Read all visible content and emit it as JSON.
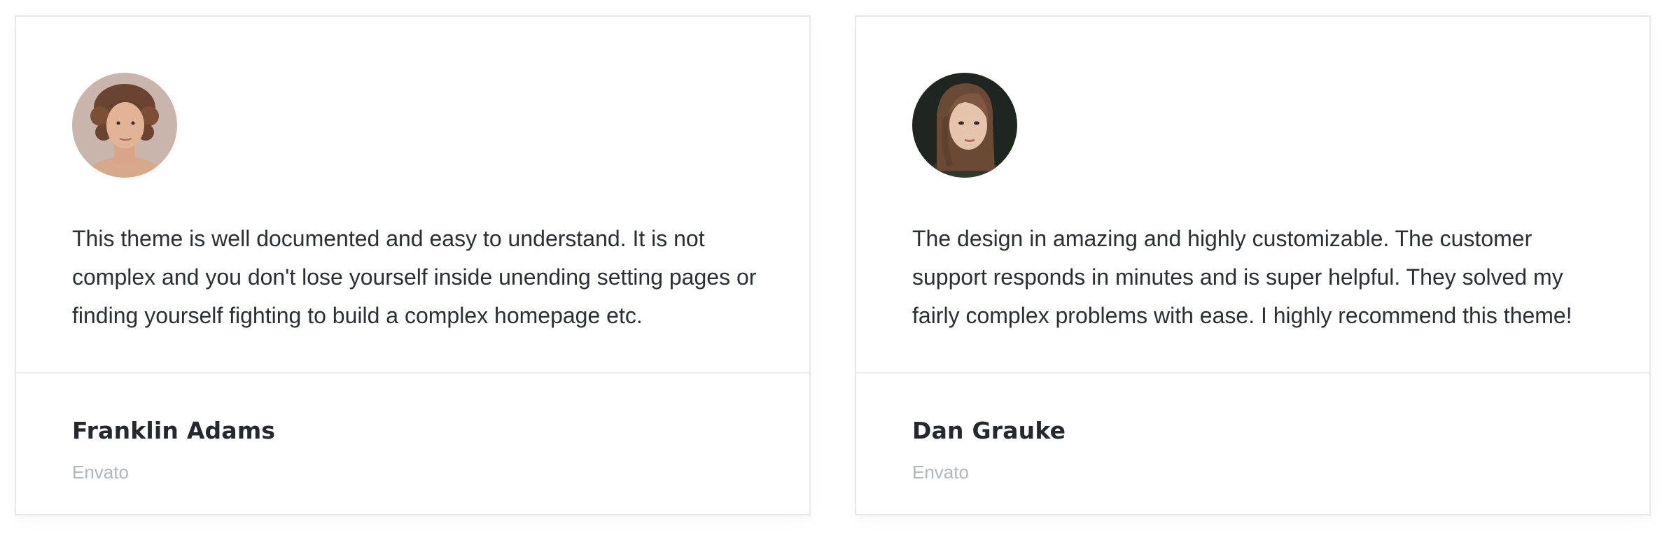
{
  "testimonials": [
    {
      "avatar_icon": "person-curly-hair-avatar",
      "quote": "This theme is well documented and easy to understand. It is not complex and you don't lose yourself inside unending setting pages or finding yourself fighting to build a complex homepage etc.",
      "name": "Franklin Adams",
      "company": "Envato"
    },
    {
      "avatar_icon": "person-long-hair-avatar",
      "quote": "The design in amazing and highly customizable. The customer support responds in minutes and is super helpful. They solved my fairly complex problems with ease. I highly recommend this theme!",
      "name": "Dan Grauke",
      "company": "Envato"
    }
  ],
  "colors": {
    "text": "#2b2f33",
    "name": "#25292d",
    "muted": "#b3b6b9",
    "border": "#e8e8e8"
  }
}
